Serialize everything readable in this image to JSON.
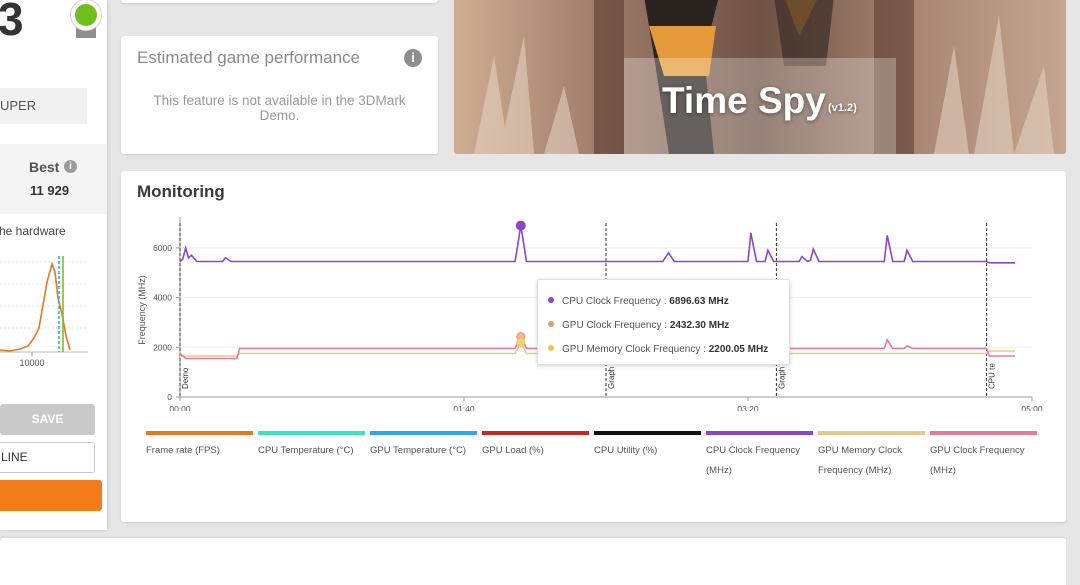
{
  "left_panel": {
    "score_fragment": "3",
    "gpu_name_fragment": "UPER",
    "best_label": "Best",
    "best_info_glyph": "i",
    "best_value": "11 929",
    "hardware_text_fragment": "he hardware",
    "mini_chart_tick": "10000",
    "save_label": "SAVE",
    "online_label": "LINE"
  },
  "estimated": {
    "title": "Estimated game performance",
    "info_glyph": "i",
    "message": "This feature is not available in the 3DMark Demo."
  },
  "banner": {
    "title": "Time Spy",
    "version": "(v1.2)"
  },
  "monitoring": {
    "title": "Monitoring",
    "tooltip": [
      {
        "label": "CPU Clock Frequency : ",
        "value": "6896.63 MHz",
        "color": "#8e44c8"
      },
      {
        "label": "GPU Clock Frequency : ",
        "value": "2432.30 MHz",
        "color": "#e9967a"
      },
      {
        "label": "GPU Memory Clock Frequency : ",
        "value": "2200.05 MHz",
        "color": "#e6c94a"
      }
    ],
    "legend": [
      {
        "label": "Frame rate (FPS)",
        "color": "#e87722"
      },
      {
        "label": "CPU Temperature (°C)",
        "color": "#33e6c0"
      },
      {
        "label": "GPU Temperature (°C)",
        "color": "#2aa8e8"
      },
      {
        "label": "GPU Load (%)",
        "color": "#c62828"
      },
      {
        "label": "CPU Utility (%)",
        "color": "#111111"
      },
      {
        "label": "CPU Clock Frequency (MHz)",
        "color": "#8e44c8"
      },
      {
        "label": "GPU Memory Clock Frequency (MHz)",
        "color": "#e6c98a"
      },
      {
        "label": "GPU Clock Frequency (MHz)",
        "color": "#e57aa0"
      }
    ]
  },
  "chart_data": {
    "type": "line",
    "title": "",
    "xlabel": "",
    "ylabel": "Frequency (MHz)",
    "x_ticks": [
      "00:00",
      "01:40",
      "03:20",
      "05:00"
    ],
    "y_ticks": [
      "0",
      "2000",
      "4000",
      "6000"
    ],
    "xlim": [
      0,
      300
    ],
    "ylim": [
      0,
      7000
    ],
    "markers": [
      {
        "x": 0,
        "label": "Demo"
      },
      {
        "x": 150,
        "label": "Graph"
      },
      {
        "x": 210,
        "label": "Graph"
      },
      {
        "x": 284,
        "label": "CPU te"
      }
    ],
    "series": [
      {
        "name": "CPU Clock Frequency (MHz)",
        "color": "#8e44c8",
        "points": [
          [
            0,
            5450
          ],
          [
            1,
            5550
          ],
          [
            2,
            6000
          ],
          [
            3,
            5600
          ],
          [
            4,
            5700
          ],
          [
            6,
            5450
          ],
          [
            15,
            5450
          ],
          [
            16,
            5600
          ],
          [
            18,
            5450
          ],
          [
            60,
            5450
          ],
          [
            70,
            5450
          ],
          [
            118,
            5450
          ],
          [
            120,
            6896
          ],
          [
            122,
            5450
          ],
          [
            150,
            5450
          ],
          [
            170,
            5450
          ],
          [
            172,
            5800
          ],
          [
            174,
            5450
          ],
          [
            200,
            5450
          ],
          [
            201,
            6600
          ],
          [
            203,
            5450
          ],
          [
            206,
            5450
          ],
          [
            207,
            5900
          ],
          [
            209,
            5450
          ],
          [
            218,
            5450
          ],
          [
            219,
            5650
          ],
          [
            221,
            5450
          ],
          [
            222,
            5500
          ],
          [
            223,
            5950
          ],
          [
            225,
            5450
          ],
          [
            248,
            5450
          ],
          [
            249,
            6500
          ],
          [
            251,
            5450
          ],
          [
            255,
            5450
          ],
          [
            256,
            5900
          ],
          [
            258,
            5450
          ],
          [
            270,
            5450
          ],
          [
            284,
            5450
          ],
          [
            285,
            5400
          ],
          [
            294,
            5400
          ]
        ]
      },
      {
        "name": "GPU Clock Frequency (MHz)",
        "color": "#e57aa0",
        "points": [
          [
            0,
            1750
          ],
          [
            2,
            1550
          ],
          [
            10,
            1550
          ],
          [
            20,
            1550
          ],
          [
            21,
            1950
          ],
          [
            40,
            1950
          ],
          [
            60,
            1950
          ],
          [
            90,
            1950
          ],
          [
            118,
            1950
          ],
          [
            120,
            2432
          ],
          [
            122,
            1950
          ],
          [
            150,
            1950
          ],
          [
            180,
            1950
          ],
          [
            199,
            1950
          ],
          [
            200,
            2100
          ],
          [
            215,
            1950
          ],
          [
            248,
            1950
          ],
          [
            249,
            2300
          ],
          [
            251,
            1950
          ],
          [
            255,
            1950
          ],
          [
            256,
            2050
          ],
          [
            258,
            1950
          ],
          [
            284,
            1950
          ],
          [
            285,
            1650
          ],
          [
            294,
            1650
          ]
        ]
      },
      {
        "name": "GPU Memory Clock Frequency (MHz)",
        "color": "#e6c98a",
        "points": [
          [
            0,
            1650
          ],
          [
            20,
            1650
          ],
          [
            21,
            1750
          ],
          [
            60,
            1750
          ],
          [
            118,
            1750
          ],
          [
            120,
            2200
          ],
          [
            122,
            1750
          ],
          [
            200,
            1750
          ],
          [
            210,
            1750
          ],
          [
            284,
            1750
          ],
          [
            285,
            1850
          ],
          [
            294,
            1850
          ]
        ]
      }
    ]
  }
}
